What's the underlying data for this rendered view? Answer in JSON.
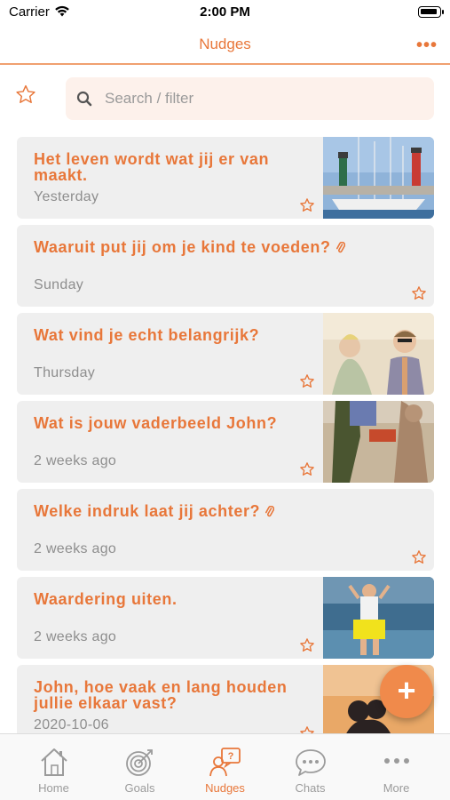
{
  "status_bar": {
    "carrier": "Carrier",
    "time": "2:00 PM"
  },
  "navbar": {
    "title": "Nudges"
  },
  "search": {
    "placeholder": "Search / filter"
  },
  "nudges": [
    {
      "title": "Het leven wordt wat jij er van maakt.",
      "date": "Yesterday",
      "has_image": true,
      "has_attachment": false
    },
    {
      "title": "Waaruit put jij om je kind te voeden?",
      "date": "Sunday",
      "has_image": false,
      "has_attachment": true
    },
    {
      "title": "Wat vind je echt belangrijk?",
      "date": "Thursday",
      "has_image": true,
      "has_attachment": false
    },
    {
      "title": "Wat is jouw vaderbeeld John?",
      "date": "2 weeks ago",
      "has_image": true,
      "has_attachment": false
    },
    {
      "title": "Welke indruk laat jij achter?",
      "date": "2 weeks ago",
      "has_image": false,
      "has_attachment": true
    },
    {
      "title": "Waardering uiten.",
      "date": "2 weeks ago",
      "has_image": true,
      "has_attachment": false
    },
    {
      "title": "John, hoe vaak en lang houden jullie elkaar vast?",
      "date": "2020-10-06",
      "has_image": true,
      "has_attachment": false
    }
  ],
  "fab": {
    "label": "+"
  },
  "tabbar": {
    "tabs": [
      {
        "label": "Home",
        "icon": "home-icon",
        "active": false
      },
      {
        "label": "Goals",
        "icon": "target-icon",
        "active": false
      },
      {
        "label": "Nudges",
        "icon": "nudges-icon",
        "active": true
      },
      {
        "label": "Chats",
        "icon": "chat-icon",
        "active": false
      },
      {
        "label": "More",
        "icon": "more-icon",
        "active": false
      }
    ]
  },
  "colors": {
    "accent": "#e8773a",
    "card_bg": "#efefef",
    "search_bg": "#fdf1eb",
    "fab": "#f08a4b"
  }
}
